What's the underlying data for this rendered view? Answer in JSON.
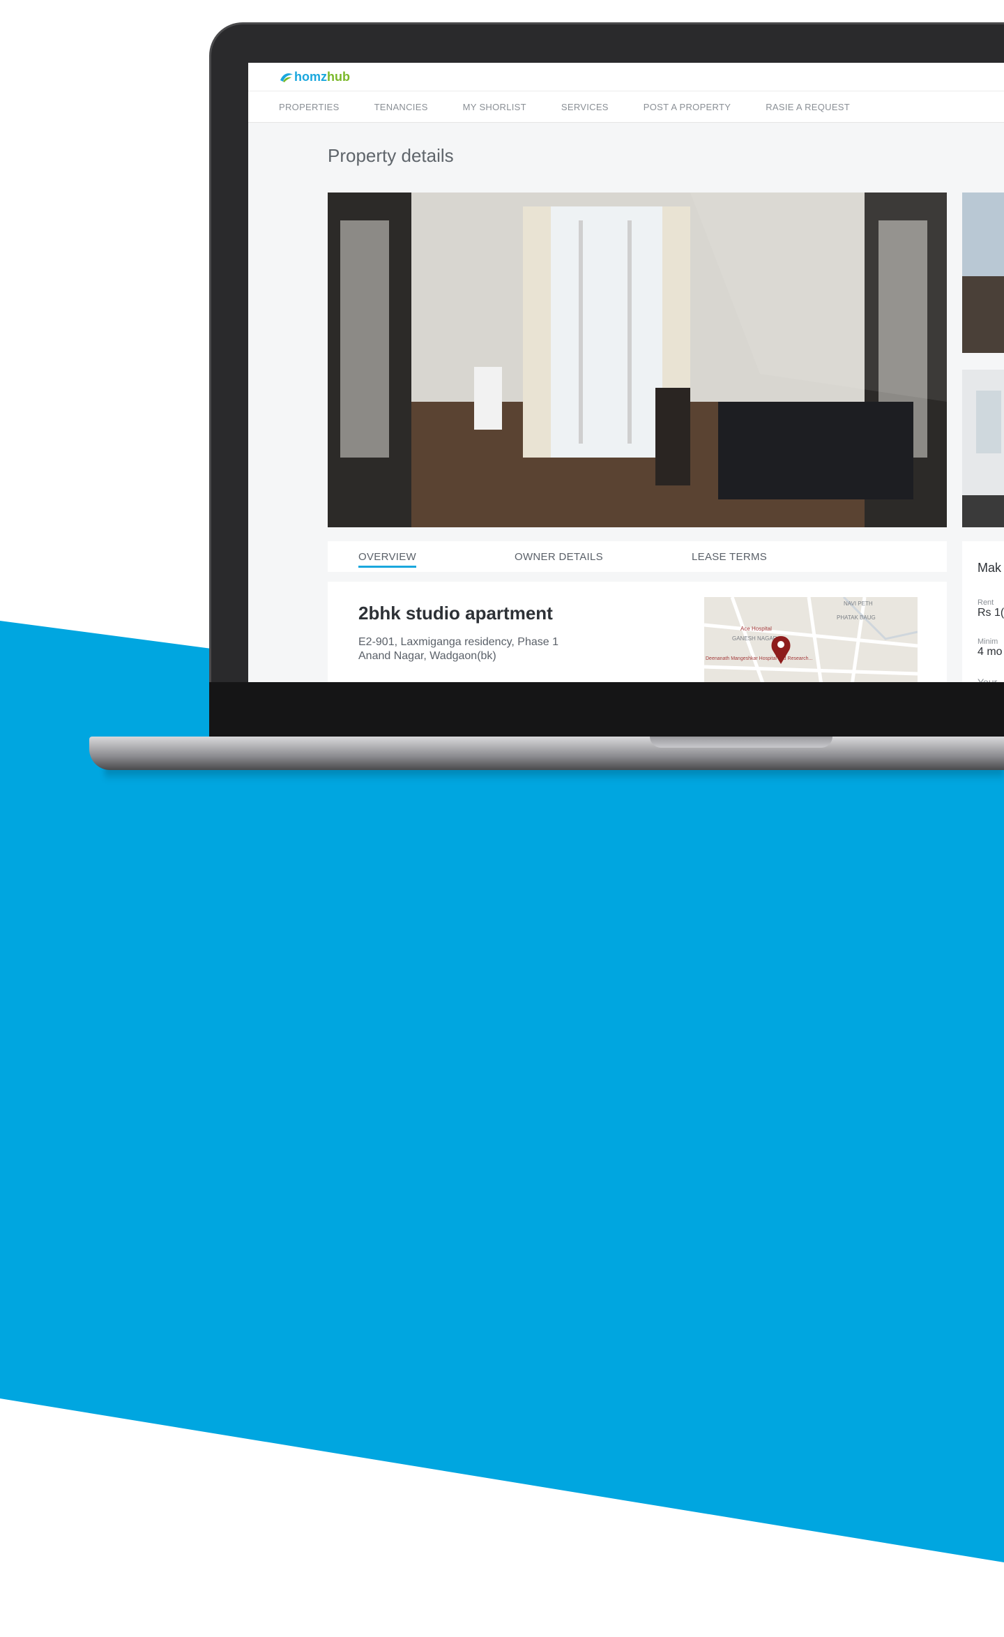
{
  "brand": {
    "logo_part1": "homz",
    "logo_part2": "hub",
    "accent": "#1aa7dd",
    "accent2": "#7ab829",
    "band_color": "#00a6e0"
  },
  "nav": {
    "items": [
      "PROPERTIES",
      "TENANCIES",
      "MY SHORLIST",
      "SERVICES",
      "POST A PROPERTY",
      "RASIE A REQUEST"
    ]
  },
  "page": {
    "title": "Property details"
  },
  "tabs": [
    "OVERVIEW",
    "OWNER DETAILS",
    "LEASE TERMS"
  ],
  "property": {
    "name": "2bhk studio apartment",
    "address_line1": "E2-901, Laxmiganga residency, Phase 1",
    "address_line2": "Anand Nagar, Wadgaon(bk)"
  },
  "map": {
    "labels": [
      "NAVI PETH",
      "PHATAK BAUG",
      "Ace Hospital",
      "GANESH NAGAR",
      "Deenanath Mangeshkar Hospital and Research..."
    ]
  },
  "side_panel": {
    "heading": "Mak",
    "rent_label": "Rent",
    "rent_value": "Rs 1(",
    "min_label": "Minim",
    "min_value": "4 mo",
    "your_label": "Your"
  }
}
